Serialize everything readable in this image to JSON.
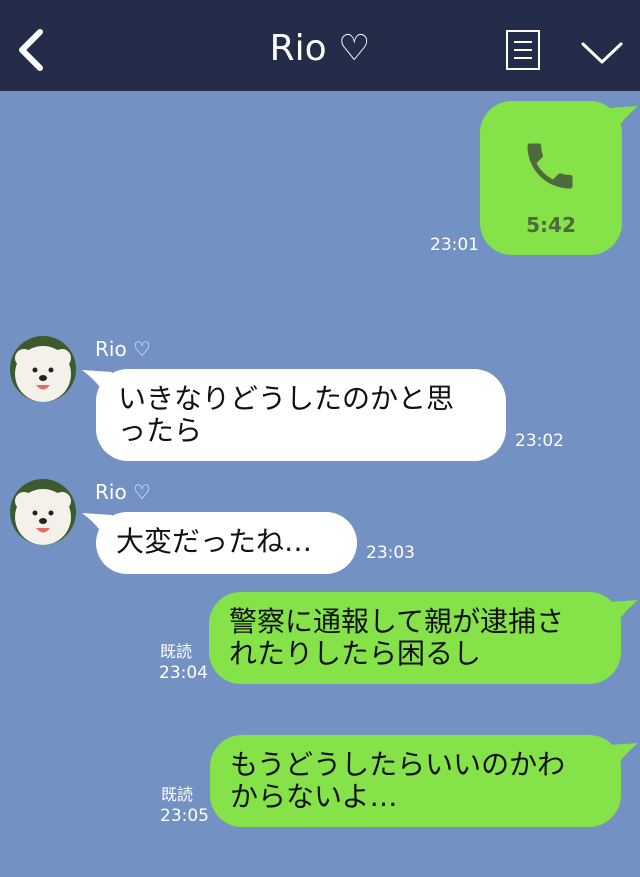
{
  "header": {
    "title": "Rio ♡",
    "back_icon": "chevron-left-icon",
    "memo_icon": "note-icon",
    "menu_icon": "chevron-down-icon"
  },
  "messages": [
    {
      "type": "call",
      "side": "right",
      "duration": "5:42",
      "time": "23:01"
    },
    {
      "type": "text",
      "side": "left",
      "sender": "Rio ♡",
      "text_line1": "いきなりどうしたのかと思",
      "text_line2": "ったら",
      "time": "23:02"
    },
    {
      "type": "text",
      "side": "left",
      "sender": "Rio ♡",
      "text_line1": "大変だったね…",
      "time": "23:03"
    },
    {
      "type": "text",
      "side": "right",
      "read": "既読",
      "text_line1": "警察に通報して親が逮捕さ",
      "text_line2": "れたりしたら困るし",
      "time": "23:04"
    },
    {
      "type": "text",
      "side": "right",
      "read": "既読",
      "text_line1": "もうどうしたらいいのかわ",
      "text_line2": "からないよ…",
      "time": "23:05"
    }
  ],
  "colors": {
    "header_bg": "#232d49",
    "chat_bg": "#7391c3",
    "my_bubble": "#85e249",
    "their_bubble": "#ffffff"
  }
}
